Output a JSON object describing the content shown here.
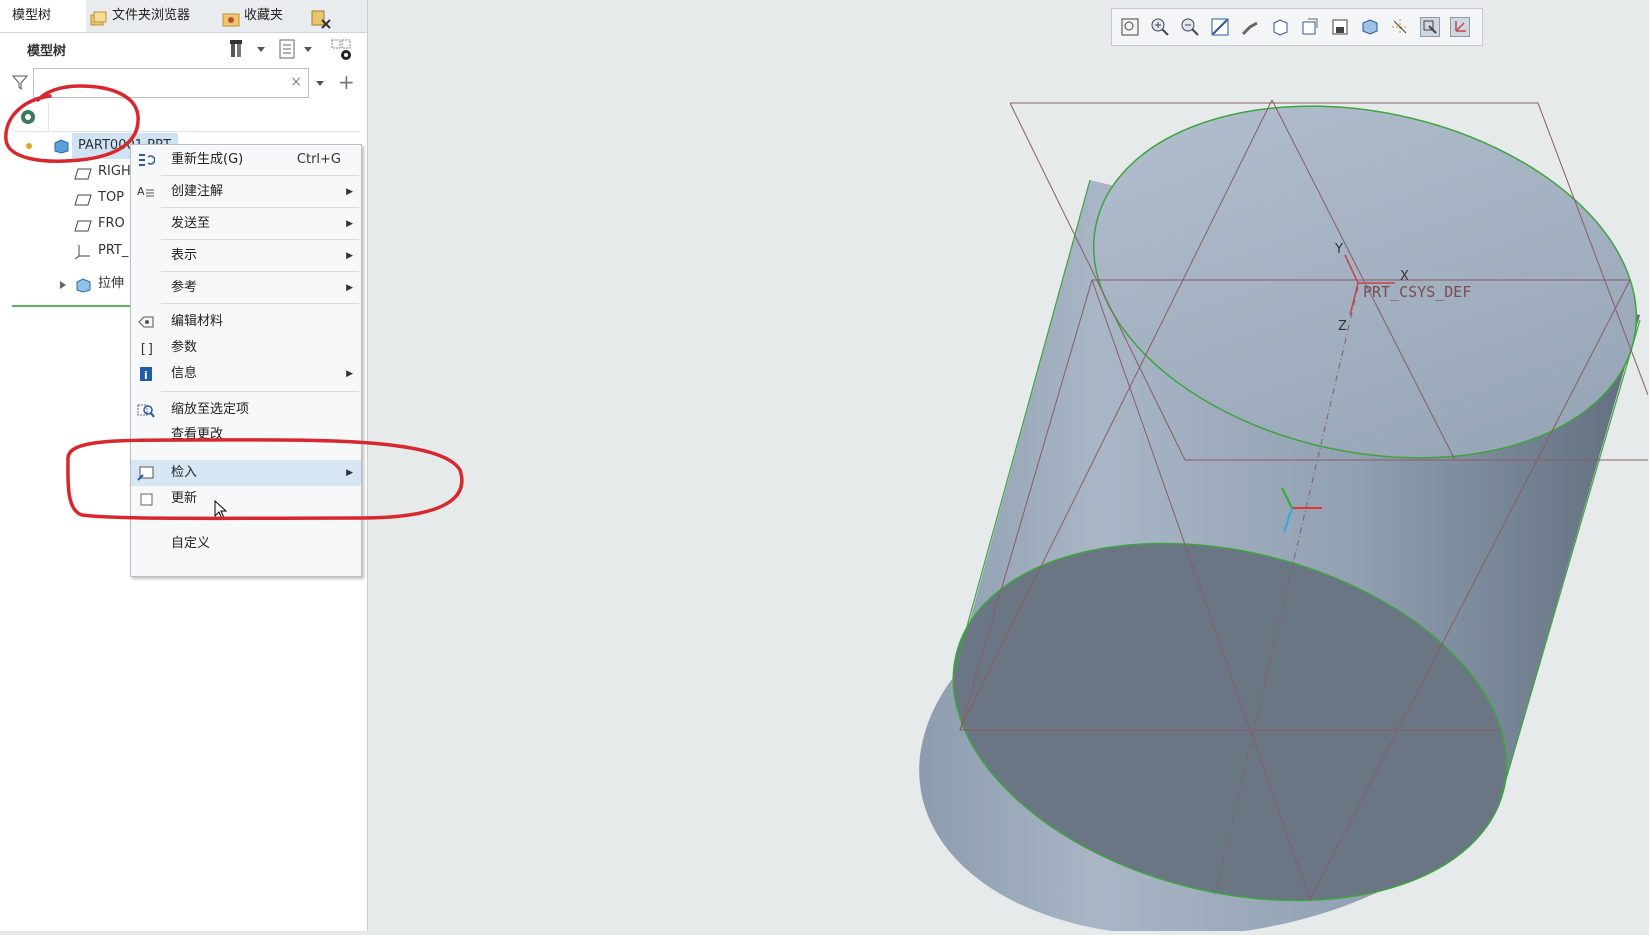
{
  "tabs": [
    {
      "label": "模型树"
    },
    {
      "label": "文件夹浏览器"
    },
    {
      "label": "收藏夹"
    }
  ],
  "model_tree_label": "模型树",
  "search": {
    "value": "",
    "clear_glyph": "×",
    "add_glyph": "+"
  },
  "tree": {
    "part": "PART0001.PRT",
    "items": [
      {
        "label": "RIGHT",
        "visible": "RIGH"
      },
      {
        "label": "TOP",
        "visible": "TOP"
      },
      {
        "label": "FRONT",
        "visible": "FRO"
      },
      {
        "label": "PRT_CSYS_DEF",
        "visible": "PRT_"
      },
      {
        "label": "拉伸",
        "visible": "拉伸"
      }
    ]
  },
  "context_menu": {
    "items": [
      {
        "label": "重新生成(G)",
        "shortcut": "Ctrl+G"
      },
      {
        "label": "创建注解"
      },
      {
        "label": "发送至"
      },
      {
        "label": "表示"
      },
      {
        "label": "参考"
      },
      {
        "label": "编辑材料"
      },
      {
        "label": "参数"
      },
      {
        "label": "信息"
      },
      {
        "label": "缩放至选定项"
      },
      {
        "label": "查看更改"
      },
      {
        "label": "检入"
      },
      {
        "label": "更新"
      },
      {
        "label": "自定义"
      }
    ],
    "submenu_glyph": "▶"
  },
  "viewport": {
    "csys_label": "PRT_CSYS_DEF",
    "axes": {
      "x": "X",
      "y": "Y",
      "z": "Z"
    }
  },
  "colors": {
    "accent_highlight": "#d6e6f5",
    "annotation_red": "#d9272e",
    "edge_green": "#3fa43f",
    "datum_plane": "#8a5c63",
    "solid": "#9aa8b8"
  },
  "icons": {
    "view_toolbar": [
      "zoom-fit-icon",
      "zoom-in-icon",
      "zoom-out-icon",
      "repaint-icon",
      "spin-center-icon",
      "display-style-icon",
      "saved-orientations-icon",
      "view-manager-icon",
      "perspective-icon",
      "datum-display-icon",
      "annotation-display-icon",
      "csys-display-icon"
    ]
  }
}
